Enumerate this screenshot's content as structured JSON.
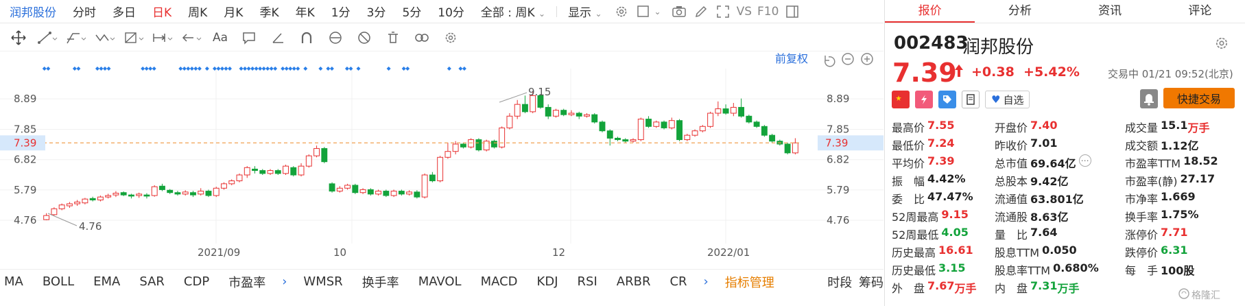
{
  "toolbar": {
    "stock_name": "润邦股份",
    "timeframes": [
      "分时",
      "多日",
      "日K",
      "周K",
      "月K",
      "季K",
      "年K",
      "1分",
      "3分",
      "5分",
      "10分"
    ],
    "active_timeframe": "日K",
    "dropdown_label": "全部 : 周K",
    "display_label": "显示",
    "vs_label": "VS",
    "f10_label": "F10"
  },
  "chart": {
    "restore_label": "前复权",
    "current_price_label": "7.39",
    "yticks": [
      "8.89",
      "7.85",
      "6.82",
      "5.79",
      "4.76"
    ],
    "xticks": [
      "2021/09",
      "10",
      "12",
      "2022/01"
    ],
    "high_annotation": "9.15",
    "low_annotation": "4.76"
  },
  "chart_data": {
    "type": "candlestick",
    "ylim": [
      4.2,
      9.8
    ],
    "yticks": [
      4.76,
      5.79,
      6.82,
      7.85,
      8.89
    ],
    "current_price": 7.39,
    "x_ticks": [
      "2021/09",
      "10",
      "12",
      "2022/01"
    ],
    "candles": [
      [
        4.78,
        4.92,
        4.76,
        5.0
      ],
      [
        4.95,
        5.15,
        4.92,
        5.2
      ],
      [
        5.15,
        5.28,
        5.1,
        5.33
      ],
      [
        5.25,
        5.32,
        5.18,
        5.38
      ],
      [
        5.32,
        5.38,
        5.25,
        5.45
      ],
      [
        5.35,
        5.48,
        5.3,
        5.52
      ],
      [
        5.5,
        5.45,
        5.4,
        5.56
      ],
      [
        5.45,
        5.55,
        5.4,
        5.6
      ],
      [
        5.55,
        5.6,
        5.5,
        5.66
      ],
      [
        5.62,
        5.68,
        5.55,
        5.75
      ],
      [
        5.7,
        5.62,
        5.58,
        5.74
      ],
      [
        5.62,
        5.58,
        5.5,
        5.66
      ],
      [
        5.6,
        5.65,
        5.52,
        5.7
      ],
      [
        5.62,
        5.58,
        5.5,
        5.68
      ],
      [
        5.6,
        5.9,
        5.56,
        5.95
      ],
      [
        5.92,
        5.8,
        5.75,
        6.0
      ],
      [
        5.78,
        5.7,
        5.65,
        5.82
      ],
      [
        5.7,
        5.65,
        5.6,
        5.76
      ],
      [
        5.65,
        5.72,
        5.6,
        5.78
      ],
      [
        5.7,
        5.62,
        5.55,
        5.76
      ],
      [
        5.65,
        5.75,
        5.6,
        5.85
      ],
      [
        5.75,
        5.6,
        5.55,
        5.8
      ],
      [
        5.6,
        5.85,
        5.55,
        5.9
      ],
      [
        5.85,
        6.0,
        5.8,
        6.05
      ],
      [
        6.0,
        6.1,
        5.95,
        6.15
      ],
      [
        6.1,
        6.3,
        6.05,
        6.35
      ],
      [
        6.3,
        6.55,
        6.2,
        6.6
      ],
      [
        6.5,
        6.45,
        6.35,
        6.6
      ],
      [
        6.45,
        6.35,
        6.3,
        6.5
      ],
      [
        6.35,
        6.45,
        6.3,
        6.5
      ],
      [
        6.45,
        6.35,
        6.3,
        6.5
      ],
      [
        6.35,
        6.6,
        6.3,
        6.65
      ],
      [
        6.55,
        6.3,
        6.25,
        6.6
      ],
      [
        6.3,
        6.6,
        6.25,
        6.7
      ],
      [
        6.6,
        6.95,
        6.55,
        7.0
      ],
      [
        6.95,
        7.2,
        6.9,
        7.3
      ],
      [
        7.2,
        6.75,
        6.7,
        7.25
      ],
      [
        6.0,
        5.75,
        5.7,
        6.05
      ],
      [
        5.75,
        5.85,
        5.7,
        5.92
      ],
      [
        5.85,
        5.95,
        5.8,
        6.0
      ],
      [
        5.95,
        5.7,
        5.65,
        6.0
      ],
      [
        5.7,
        5.8,
        5.65,
        5.85
      ],
      [
        5.8,
        5.65,
        5.6,
        5.85
      ],
      [
        5.65,
        5.75,
        5.6,
        5.8
      ],
      [
        5.75,
        5.6,
        5.55,
        5.8
      ],
      [
        5.6,
        5.75,
        5.55,
        5.8
      ],
      [
        5.75,
        5.65,
        5.6,
        5.8
      ],
      [
        5.65,
        5.72,
        5.6,
        5.78
      ],
      [
        5.72,
        5.55,
        5.5,
        5.78
      ],
      [
        5.55,
        6.3,
        5.5,
        6.35
      ],
      [
        6.3,
        6.1,
        6.05,
        6.4
      ],
      [
        6.1,
        6.9,
        6.05,
        6.95
      ],
      [
        6.9,
        7.1,
        6.85,
        7.4
      ],
      [
        7.1,
        7.35,
        7.0,
        7.45
      ],
      [
        7.35,
        7.25,
        7.2,
        7.4
      ],
      [
        7.25,
        7.5,
        7.2,
        7.55
      ],
      [
        7.5,
        7.15,
        7.1,
        7.55
      ],
      [
        7.15,
        7.45,
        7.1,
        7.5
      ],
      [
        7.45,
        7.25,
        7.2,
        7.5
      ],
      [
        7.25,
        7.9,
        7.2,
        7.95
      ],
      [
        7.9,
        8.3,
        7.85,
        8.4
      ],
      [
        8.3,
        8.7,
        8.2,
        8.85
      ],
      [
        8.7,
        8.45,
        8.4,
        9.0
      ],
      [
        8.45,
        9.0,
        8.4,
        9.15
      ],
      [
        9.0,
        8.6,
        8.55,
        9.05
      ],
      [
        8.6,
        8.3,
        8.2,
        8.7
      ],
      [
        8.3,
        8.5,
        8.25,
        8.55
      ],
      [
        8.5,
        8.35,
        8.3,
        8.55
      ],
      [
        8.35,
        8.4,
        8.3,
        8.5
      ],
      [
        8.4,
        8.3,
        8.2,
        8.45
      ],
      [
        8.3,
        8.35,
        8.25,
        8.4
      ],
      [
        8.35,
        8.1,
        8.05,
        8.4
      ],
      [
        8.1,
        7.8,
        7.75,
        8.15
      ],
      [
        7.8,
        7.55,
        7.3,
        7.85
      ],
      [
        7.55,
        7.5,
        7.45,
        7.6
      ],
      [
        7.5,
        7.45,
        7.4,
        7.55
      ],
      [
        7.45,
        7.5,
        7.4,
        7.55
      ],
      [
        7.5,
        8.2,
        7.45,
        8.25
      ],
      [
        8.2,
        7.95,
        7.9,
        8.3
      ],
      [
        7.95,
        8.1,
        7.9,
        8.15
      ],
      [
        8.1,
        7.9,
        7.85,
        8.15
      ],
      [
        7.9,
        8.15,
        7.85,
        8.25
      ],
      [
        8.15,
        7.5,
        7.45,
        8.2
      ],
      [
        7.5,
        7.65,
        7.45,
        7.7
      ],
      [
        7.65,
        7.8,
        7.6,
        7.85
      ],
      [
        7.8,
        7.95,
        7.75,
        8.0
      ],
      [
        7.95,
        8.4,
        7.9,
        8.45
      ],
      [
        8.4,
        8.55,
        8.3,
        8.8
      ],
      [
        8.55,
        8.4,
        8.35,
        8.7
      ],
      [
        8.4,
        8.6,
        8.3,
        8.75
      ],
      [
        8.6,
        8.3,
        8.25,
        8.9
      ],
      [
        8.3,
        8.1,
        8.05,
        8.35
      ],
      [
        8.1,
        7.95,
        7.9,
        8.15
      ],
      [
        7.95,
        7.65,
        7.6,
        8.0
      ],
      [
        7.65,
        7.45,
        7.4,
        7.7
      ],
      [
        7.45,
        7.35,
        7.3,
        7.5
      ],
      [
        7.35,
        7.05,
        7.0,
        7.4
      ],
      [
        7.05,
        7.39,
        7.0,
        7.55
      ]
    ],
    "dot_columns": [
      0,
      1,
      8,
      9,
      14,
      15,
      16,
      17,
      26,
      27,
      28,
      29,
      36,
      37,
      38,
      39,
      40,
      41,
      43,
      45,
      46,
      47,
      48,
      49,
      52,
      53,
      54,
      55,
      56,
      57,
      58,
      59,
      60,
      61,
      63,
      64,
      65,
      66,
      67,
      69,
      73,
      75,
      76,
      80,
      81,
      83,
      91,
      95,
      96,
      107,
      110,
      111
    ]
  },
  "indicators": {
    "tabs": [
      "MA",
      "BOLL",
      "EMA",
      "SAR",
      "CDP",
      "市盈率"
    ],
    "tabs2": [
      "WMSR",
      "换手率",
      "MAVOL",
      "MACD",
      "KDJ",
      "RSI",
      "ARBR",
      "CR"
    ],
    "manage_label": "指标管理",
    "right_labels": [
      "时段",
      "筹码"
    ]
  },
  "panel": {
    "tabs": [
      "报价",
      "分析",
      "资讯",
      "评论"
    ],
    "active_tab": "报价",
    "code": "002483",
    "name": "润邦股份",
    "price": "7.39",
    "change": "+0.38",
    "change_pct": "+5.42%",
    "trade_status": "交易中 01/21 09:52(北京)",
    "watch_label": "自选",
    "fast_trade_label": "快捷交易",
    "stats": [
      [
        [
          "最高价",
          "7.55",
          "red"
        ],
        [
          "开盘价",
          "7.40",
          "red"
        ],
        [
          "成交量",
          "15.1",
          "",
          "万手"
        ]
      ],
      [
        [
          "最低价",
          "7.24",
          "red"
        ],
        [
          "昨收价",
          "7.01",
          ""
        ],
        [
          "成交额",
          "1.12亿",
          ""
        ]
      ],
      [
        [
          "平均价",
          "7.39",
          "red"
        ],
        [
          "总市值",
          "69.64亿",
          ""
        ],
        [
          "市盈率TTM",
          "18.52",
          ""
        ]
      ],
      [
        [
          "振　幅",
          "4.42%",
          ""
        ],
        [
          "总股本",
          "9.42亿",
          ""
        ],
        [
          "市盈率(静)",
          "27.17",
          ""
        ]
      ],
      [
        [
          "委　比",
          "47.47%",
          ""
        ],
        [
          "流通值",
          "63.801亿",
          ""
        ],
        [
          "市净率",
          "1.669",
          ""
        ]
      ],
      [
        [
          "52周最高",
          "9.15",
          "red"
        ],
        [
          "流通股",
          "8.63亿",
          ""
        ],
        [
          "换手率",
          "1.75%",
          ""
        ]
      ],
      [
        [
          "52周最低",
          "4.05",
          "green"
        ],
        [
          "量　比",
          "7.64",
          ""
        ],
        [
          "涨停价",
          "7.71",
          "red"
        ]
      ],
      [
        [
          "历史最高",
          "16.61",
          "red"
        ],
        [
          "股息TTM",
          "0.050",
          ""
        ],
        [
          "跌停价",
          "6.31",
          "green"
        ]
      ],
      [
        [
          "历史最低",
          "3.15",
          "green"
        ],
        [
          "股息率TTM",
          "0.680%",
          ""
        ],
        [
          "每　手",
          "100股",
          ""
        ]
      ],
      [
        [
          "外　盘",
          "7.67",
          "red",
          "万手"
        ],
        [
          "内　盘",
          "7.31",
          "green",
          "万手"
        ],
        [
          "",
          "",
          ""
        ]
      ]
    ],
    "watermark": "格隆汇"
  },
  "colors": {
    "up": "#e83030",
    "down": "#13a33b",
    "accent": "#2a6fdb",
    "dots": "#2a7fe8",
    "highlight": "#e67e00"
  }
}
